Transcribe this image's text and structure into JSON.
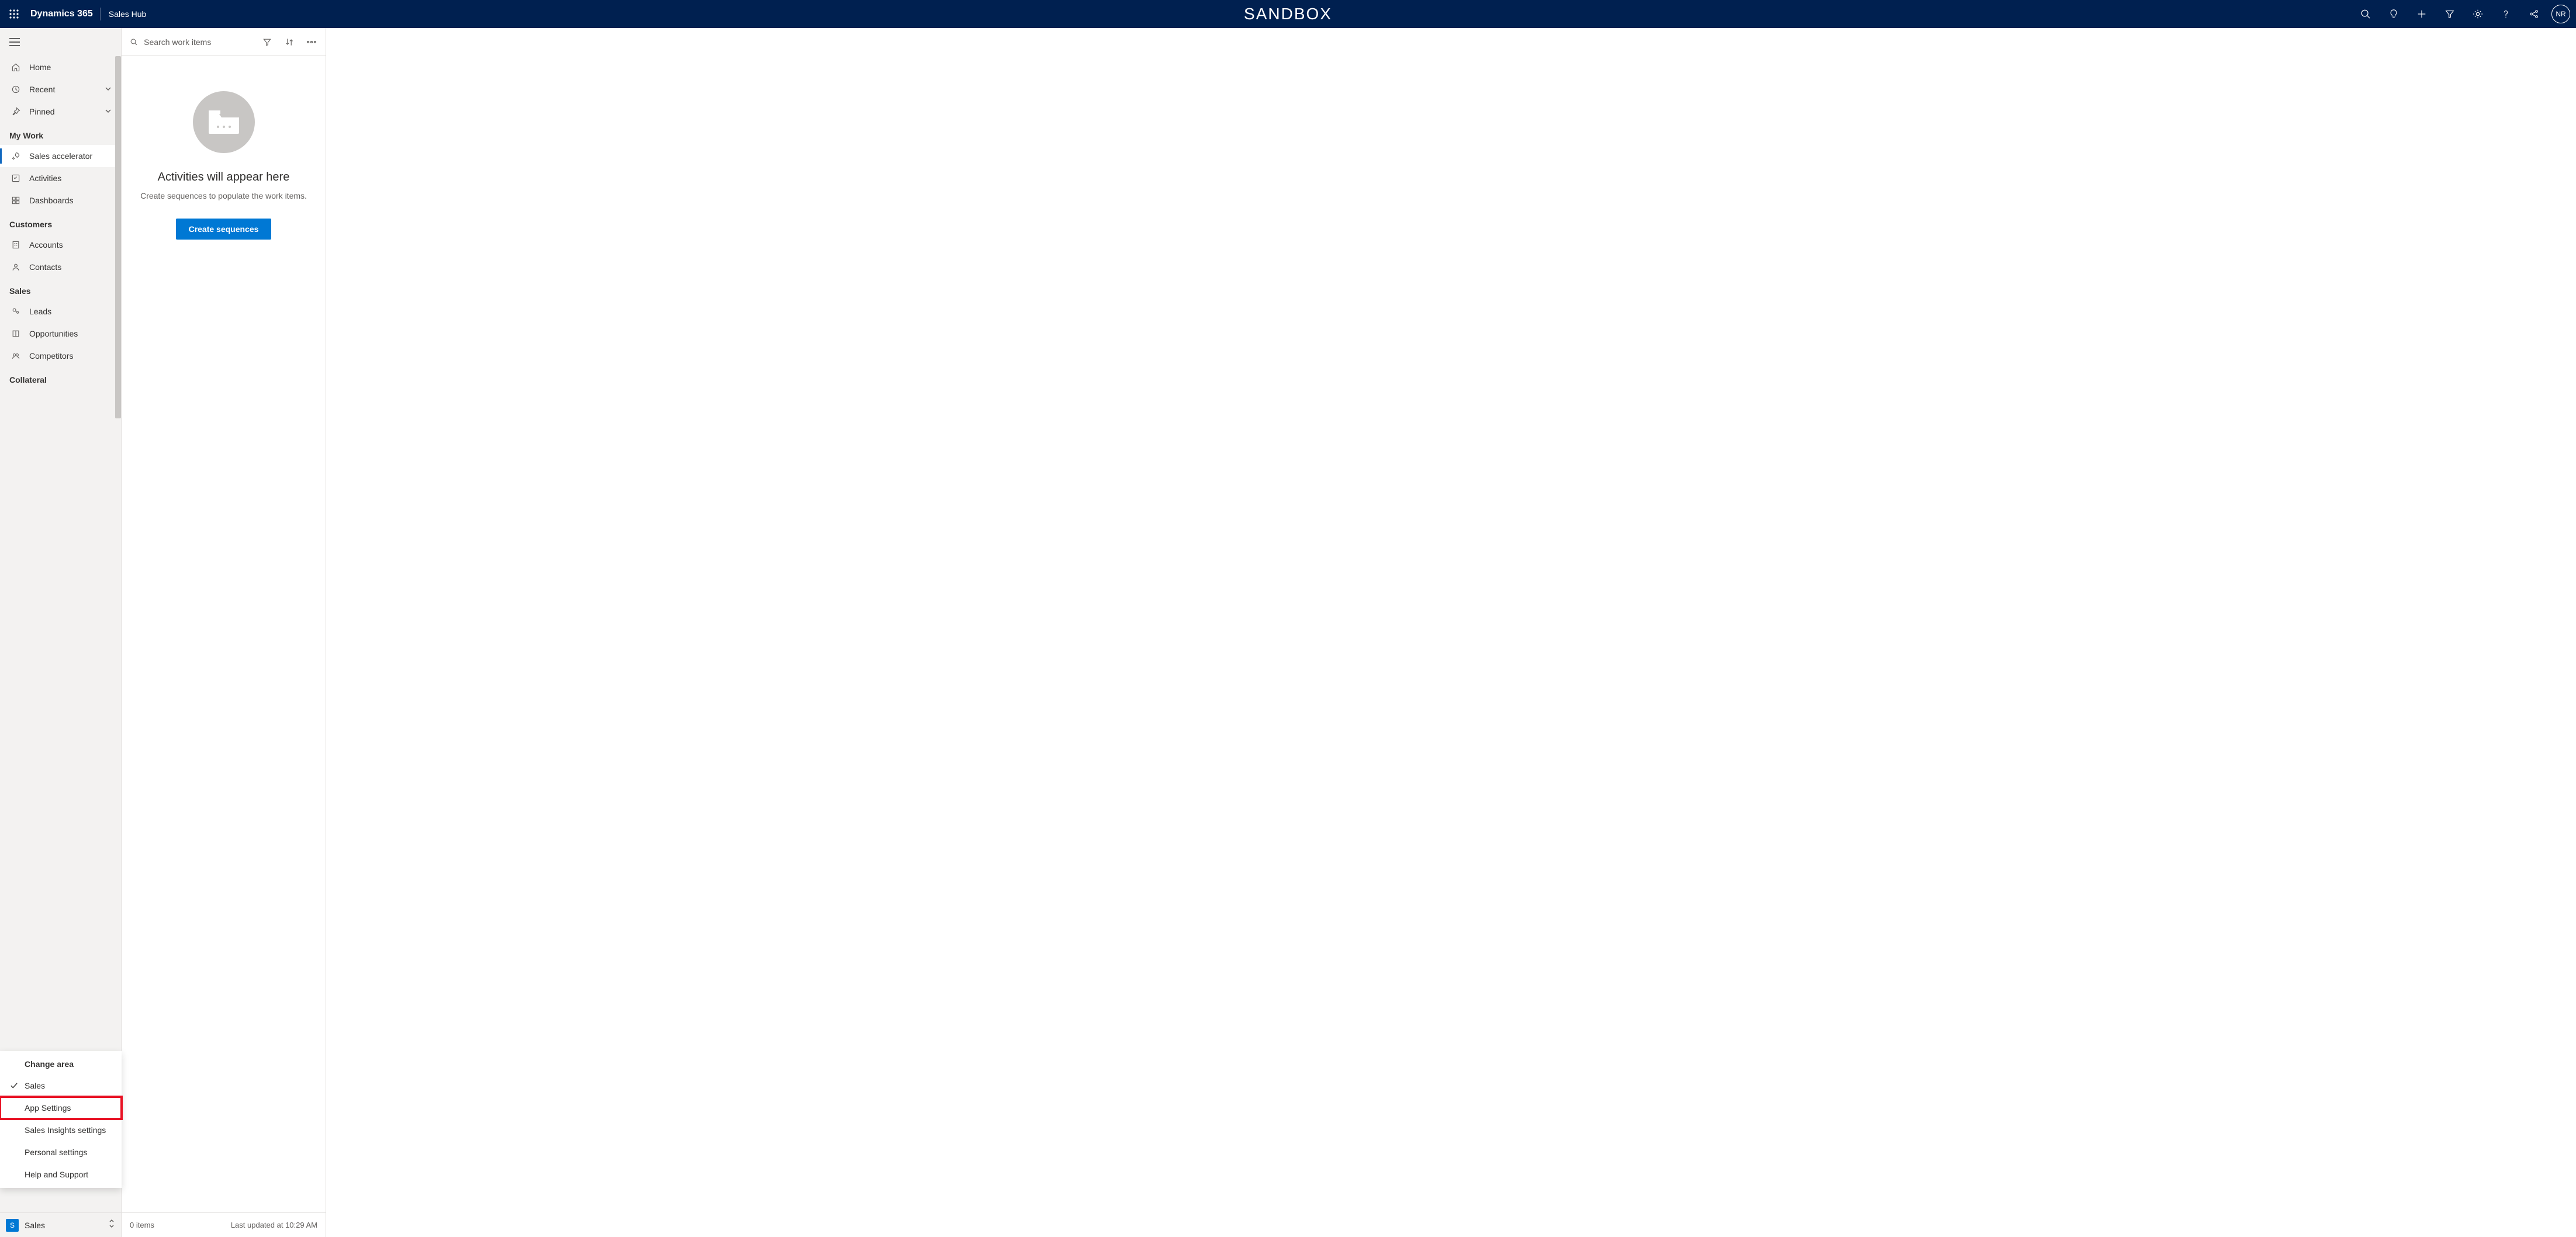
{
  "topbar": {
    "app_title": "Dynamics 365",
    "hub_name": "Sales Hub",
    "env_label": "SANDBOX",
    "avatar_initials": "NR"
  },
  "sidebar": {
    "items": {
      "home": "Home",
      "recent": "Recent",
      "pinned": "Pinned",
      "sales_accel": "Sales accelerator",
      "activities": "Activities",
      "dashboards": "Dashboards",
      "accounts": "Accounts",
      "contacts": "Contacts",
      "leads": "Leads",
      "opportunities": "Opportunities",
      "competitors": "Competitors"
    },
    "sections": {
      "my_work": "My Work",
      "customers": "Customers",
      "sales": "Sales",
      "collateral": "Collateral"
    }
  },
  "area_popup": {
    "header": "Change area",
    "options": {
      "sales": "Sales",
      "app_settings": "App Settings",
      "sales_insights": "Sales Insights settings",
      "personal": "Personal settings",
      "help": "Help and Support"
    }
  },
  "area_switcher": {
    "badge": "S",
    "label": "Sales"
  },
  "workpane": {
    "search_placeholder": "Search work items",
    "empty_title": "Activities will appear here",
    "empty_desc": "Create sequences to populate the work items.",
    "cta_label": "Create sequences",
    "footer_count": "0 items",
    "footer_update": "Last updated at 10:29 AM"
  }
}
